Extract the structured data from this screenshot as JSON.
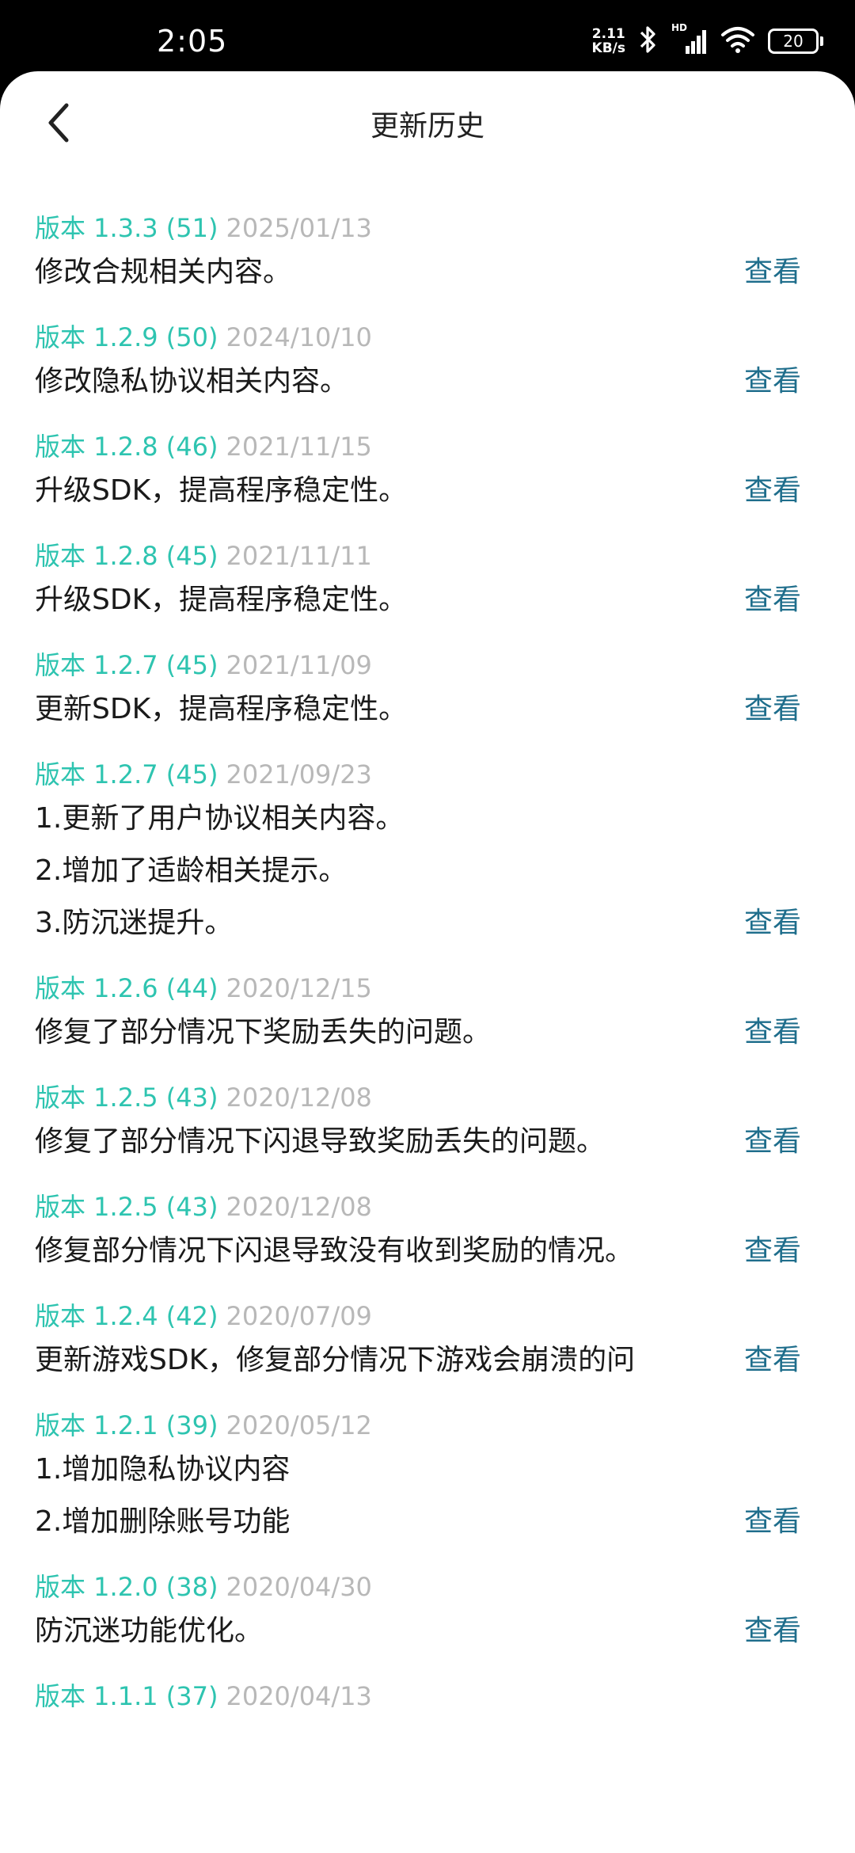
{
  "status_bar": {
    "time": "2:05",
    "net_speed_value": "2.11",
    "net_speed_unit": "KB/s",
    "hd_label": "HD",
    "battery_level": "20",
    "icons": [
      "bluetooth-icon",
      "signal-icon",
      "wifi-icon",
      "battery-icon"
    ]
  },
  "nav": {
    "back_icon": "chevron-left-icon",
    "title": "更新历史"
  },
  "colors": {
    "version": "#2ec4b0",
    "date": "#b8b8b8",
    "text": "#1a1a1a",
    "link": "#1f6e8c"
  },
  "updates": [
    {
      "version": "版本 1.3.3 (51)",
      "date": "2025/01/13",
      "lines": [
        "修改合规相关内容。"
      ],
      "action": "查看"
    },
    {
      "version": "版本 1.2.9 (50)",
      "date": "2024/10/10",
      "lines": [
        "修改隐私协议相关内容。"
      ],
      "action": "查看"
    },
    {
      "version": "版本 1.2.8 (46)",
      "date": "2021/11/15",
      "lines": [
        "升级SDK，提高程序稳定性。"
      ],
      "action": "查看"
    },
    {
      "version": "版本 1.2.8 (45)",
      "date": "2021/11/11",
      "lines": [
        "升级SDK，提高程序稳定性。"
      ],
      "action": "查看"
    },
    {
      "version": "版本 1.2.7 (45)",
      "date": "2021/11/09",
      "lines": [
        "更新SDK，提高程序稳定性。"
      ],
      "action": "查看"
    },
    {
      "version": "版本 1.2.7 (45)",
      "date": "2021/09/23",
      "lines": [
        "1.更新了用户协议相关内容。",
        "2.增加了适龄相关提示。",
        "3.防沉迷提升。"
      ],
      "action": "查看"
    },
    {
      "version": "版本 1.2.6 (44)",
      "date": "2020/12/15",
      "lines": [
        "修复了部分情况下奖励丢失的问题。"
      ],
      "action": "查看"
    },
    {
      "version": "版本 1.2.5 (43)",
      "date": "2020/12/08",
      "lines": [
        "修复了部分情况下闪退导致奖励丢失的问题。"
      ],
      "action": "查看"
    },
    {
      "version": "版本 1.2.5 (43)",
      "date": "2020/12/08",
      "lines": [
        "修复部分情况下闪退导致没有收到奖励的情况。"
      ],
      "action": "查看"
    },
    {
      "version": "版本 1.2.4 (42)",
      "date": "2020/07/09",
      "lines": [
        "更新游戏SDK，修复部分情况下游戏会崩溃的问"
      ],
      "action": "查看"
    },
    {
      "version": "版本 1.2.1 (39)",
      "date": "2020/05/12",
      "lines": [
        "1.增加隐私协议内容",
        "2.增加删除账号功能"
      ],
      "action": "查看"
    },
    {
      "version": "版本 1.2.0 (38)",
      "date": "2020/04/30",
      "lines": [
        "防沉迷功能优化。"
      ],
      "action": "查看"
    },
    {
      "version": "版本 1.1.1 (37)",
      "date": "2020/04/13",
      "lines": [],
      "action": ""
    }
  ]
}
